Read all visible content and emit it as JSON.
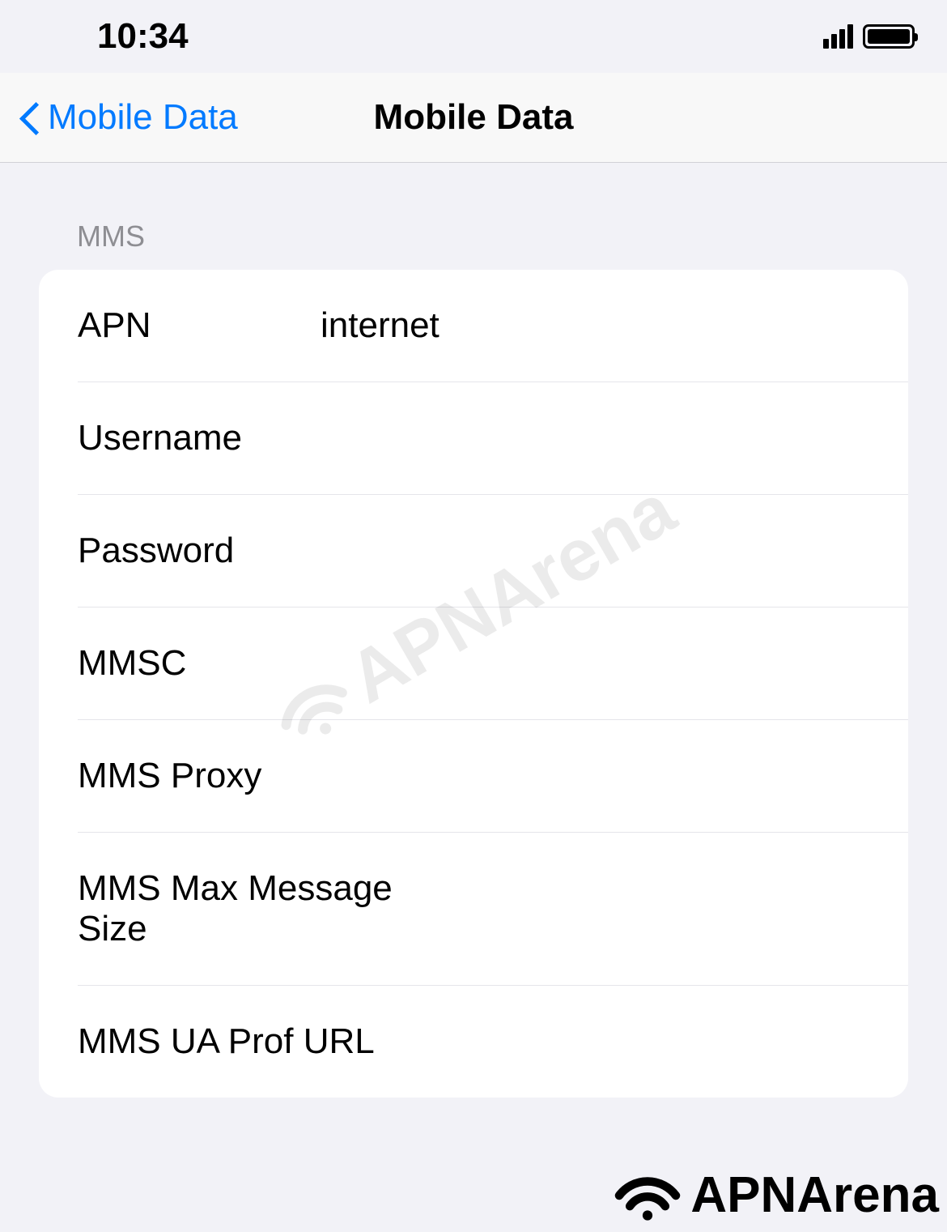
{
  "statusBar": {
    "time": "10:34"
  },
  "navBar": {
    "backLabel": "Mobile Data",
    "title": "Mobile Data"
  },
  "sectionHeader": "MMS",
  "fields": {
    "apn": {
      "label": "APN",
      "value": "internet"
    },
    "username": {
      "label": "Username",
      "value": ""
    },
    "password": {
      "label": "Password",
      "value": ""
    },
    "mmsc": {
      "label": "MMSC",
      "value": ""
    },
    "mmsProxy": {
      "label": "MMS Proxy",
      "value": ""
    },
    "mmsMaxSize": {
      "label": "MMS Max Message Size",
      "value": ""
    },
    "mmsUaProfUrl": {
      "label": "MMS UA Prof URL",
      "value": ""
    }
  },
  "watermark": {
    "text": "APNArena"
  }
}
